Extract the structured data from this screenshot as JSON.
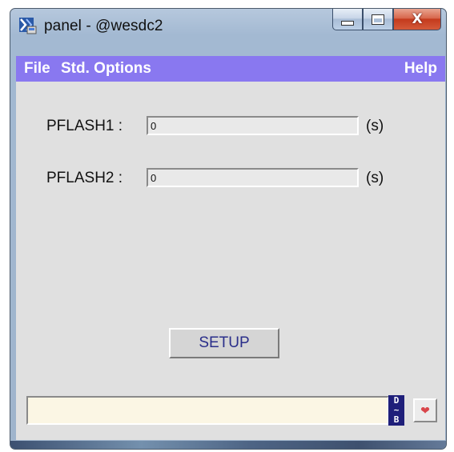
{
  "window": {
    "title": "panel - @wesdc2"
  },
  "menubar": {
    "file": "File",
    "std_options": "Std. Options",
    "help": "Help"
  },
  "fields": [
    {
      "label": "PFLASH1 :",
      "value": "0",
      "unit": "(s)"
    },
    {
      "label": "PFLASH2 :",
      "value": "0",
      "unit": "(s)"
    }
  ],
  "setup_button": "SETUP",
  "status": {
    "value": ""
  },
  "icons": {
    "app": "panel-app-icon",
    "db": "db-icon",
    "heart": "heart-icon"
  },
  "colors": {
    "menubar_bg": "#8978f0",
    "client_bg": "#e0e0e0",
    "close_button": "#c43a1d"
  }
}
